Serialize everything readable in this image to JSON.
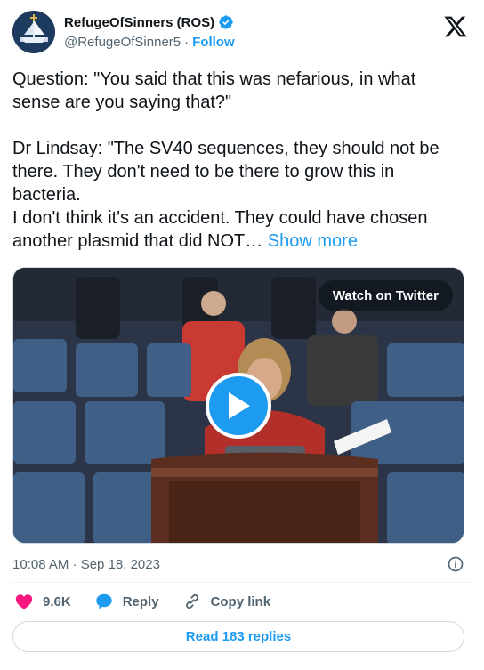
{
  "author": {
    "display_name": "RefugeOfSinners (ROS)",
    "handle": "@RefugeOfSinner5",
    "separator": "·",
    "follow_label": "Follow"
  },
  "tweet": {
    "text": "Question: \"You said that this was nefarious, in what sense are you saying that?\"\n\nDr Lindsay: \"The SV40 sequences, they should not be there. They don't need to be there to grow this in bacteria.\nI don't think it's an accident. They could have chosen another plasmid that did NOT… ",
    "show_more_label": "Show more"
  },
  "media": {
    "watch_label": "Watch on Twitter"
  },
  "meta": {
    "timestamp": "10:08 AM · Sep 18, 2023"
  },
  "actions": {
    "likes": "9.6K",
    "reply_label": "Reply",
    "copy_label": "Copy link"
  },
  "replies": {
    "label": "Read 183 replies"
  },
  "colors": {
    "accent": "#1d9bf0",
    "like": "#f91880",
    "text": "#0f1419",
    "secondary": "#536471"
  }
}
